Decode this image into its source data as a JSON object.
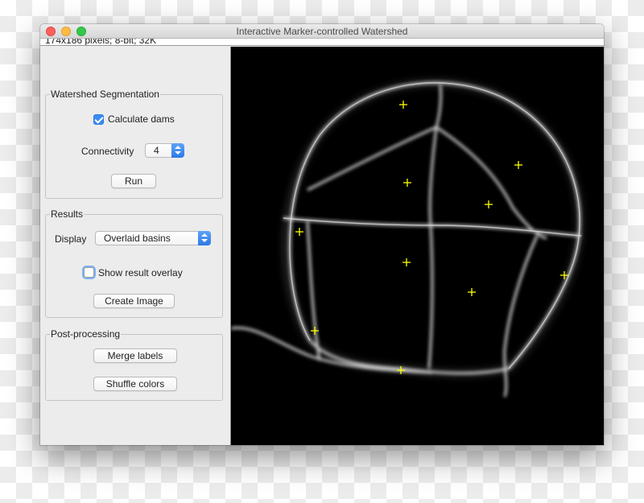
{
  "window": {
    "title": "Interactive Marker-controlled Watershed",
    "info": "174x186 pixels; 8-bit; 32K"
  },
  "watershed": {
    "group_label": "Watershed Segmentation",
    "calculate_dams_label": "Calculate dams",
    "calculate_dams_checked": true,
    "connectivity_label": "Connectivity",
    "connectivity_value": "4",
    "run_label": "Run"
  },
  "results": {
    "group_label": "Results",
    "display_label": "Display",
    "display_value": "Overlaid basins",
    "show_overlay_label": "Show result overlay",
    "show_overlay_checked": false,
    "create_image_label": "Create Image"
  },
  "postprocessing": {
    "group_label": "Post-processing",
    "merge_labels": "Merge labels",
    "shuffle_colors": "Shuffle colors"
  },
  "colors": {
    "marker": "#ffff00",
    "checkbox_accent": "#3b8cf3",
    "image_background": "#000000"
  },
  "image": {
    "marker_count": 11,
    "marker_icon": "crosshair-marker-icon"
  }
}
